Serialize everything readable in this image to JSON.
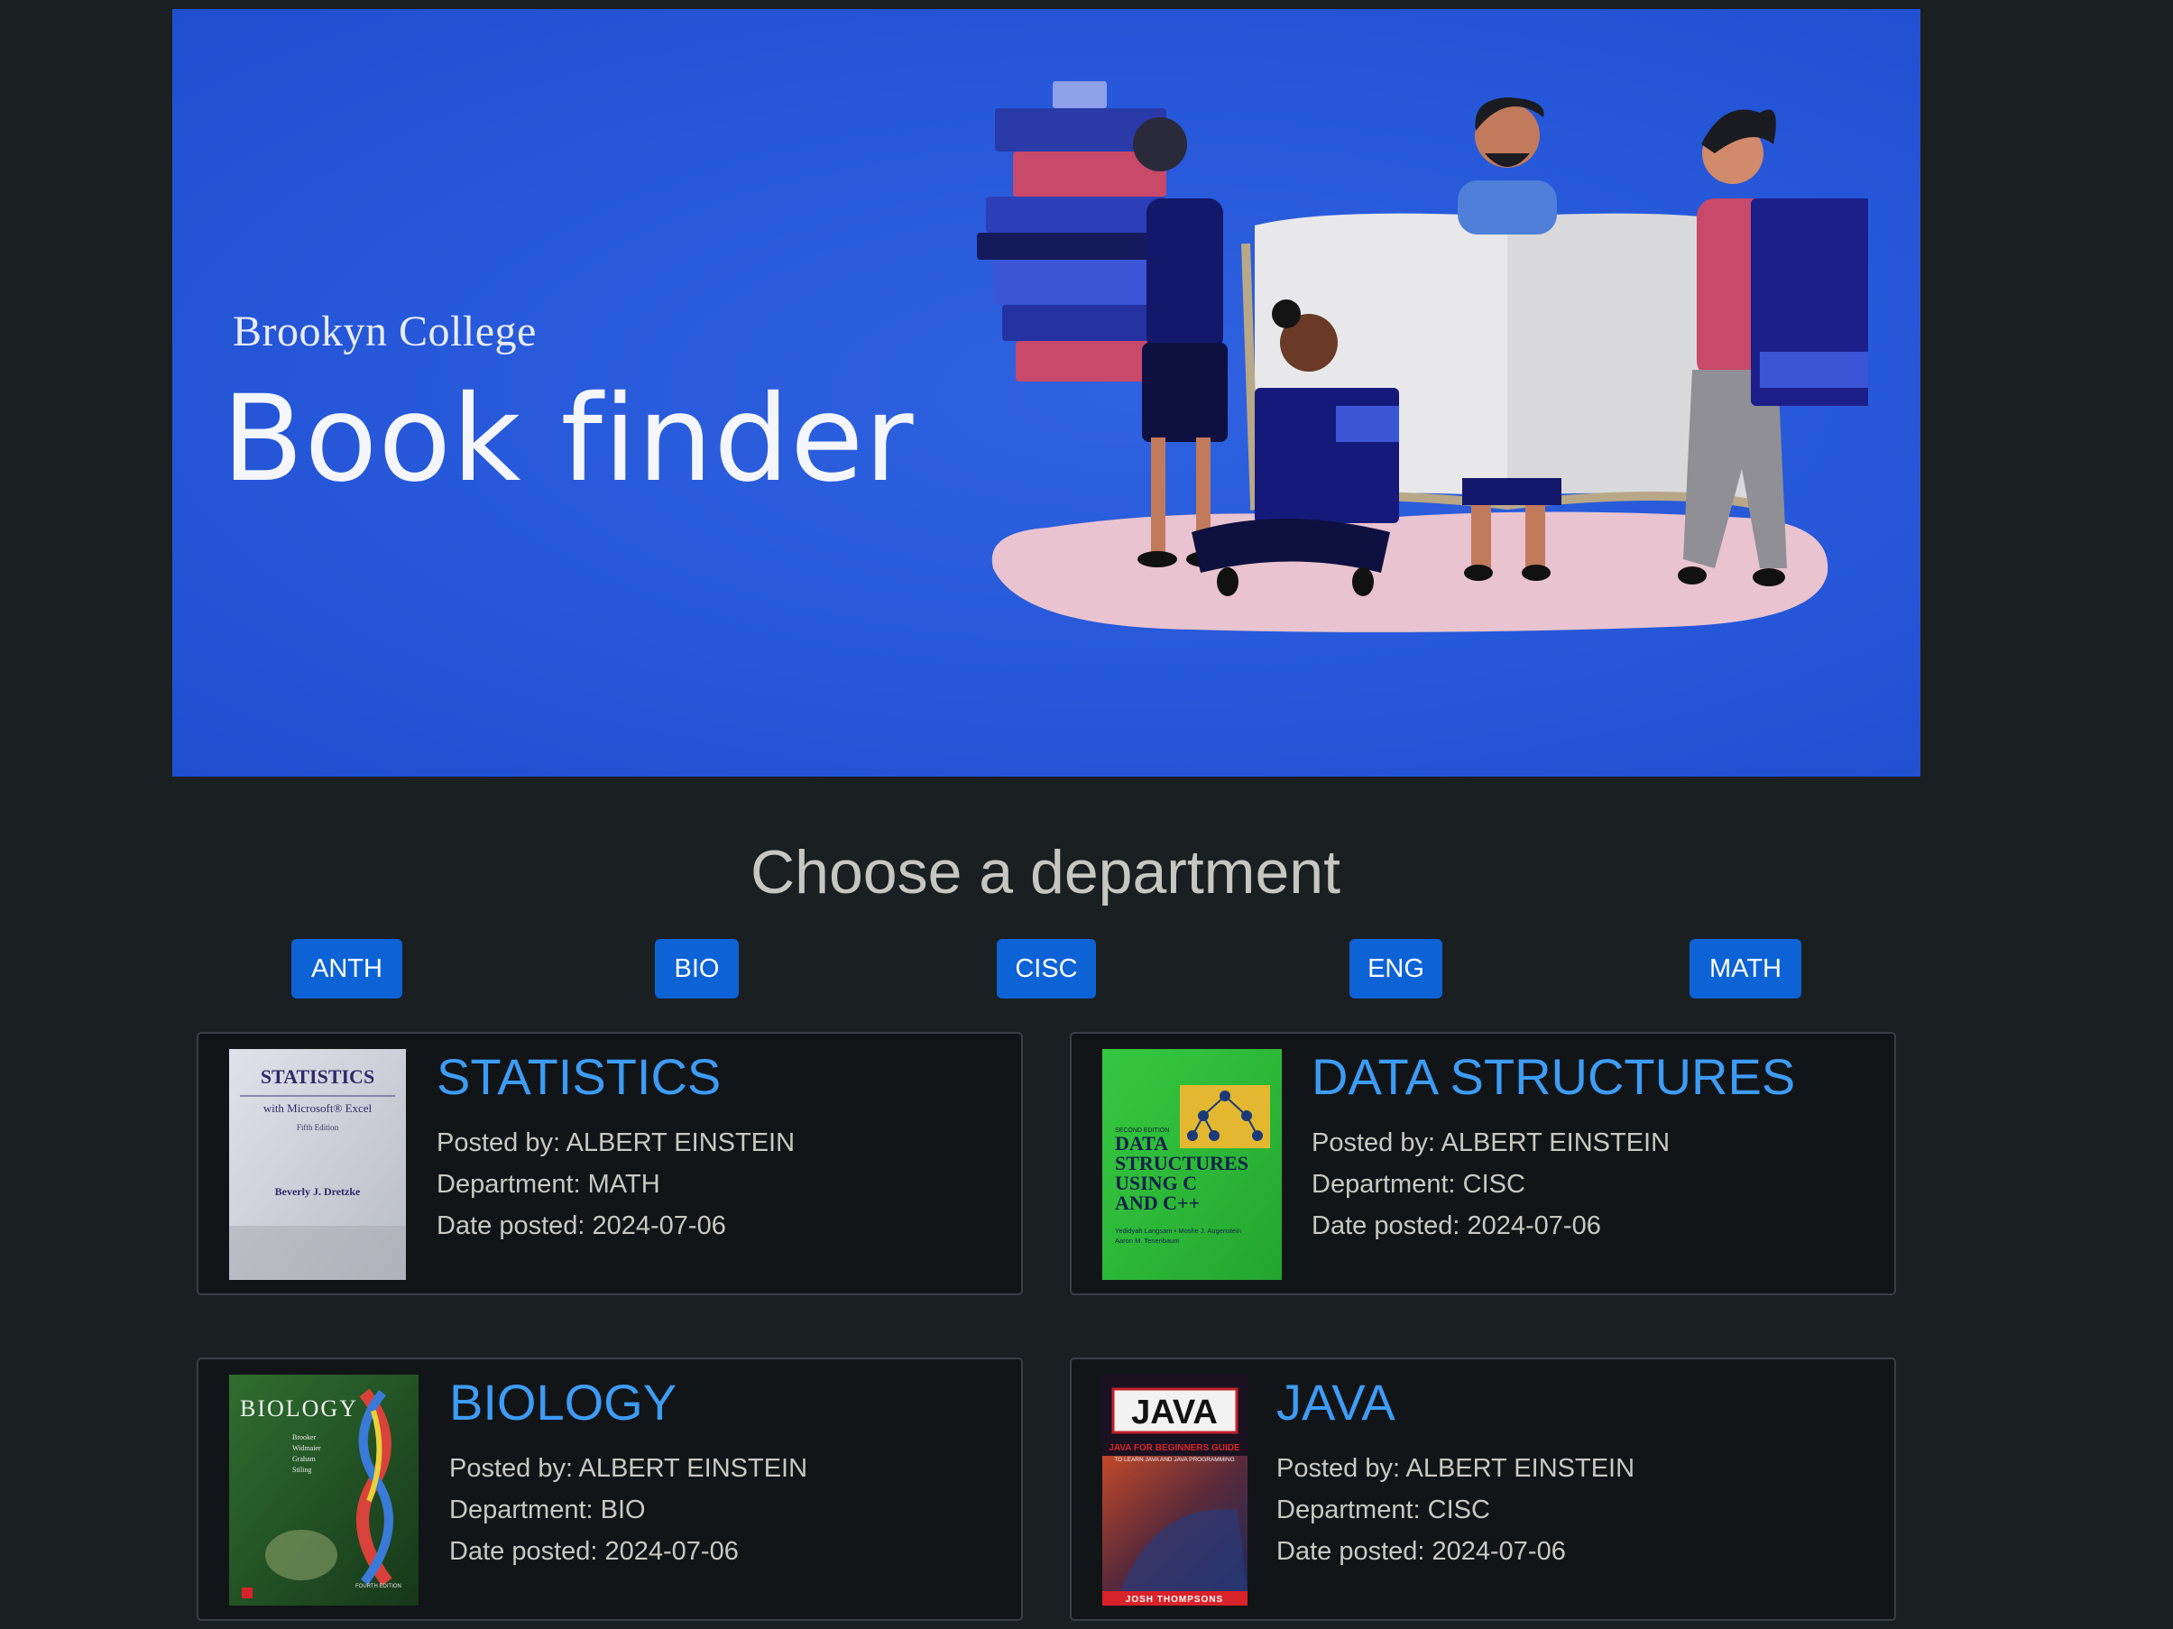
{
  "banner": {
    "subtitle": "Brookyn College",
    "title": "Book finder"
  },
  "heading": "Choose a department",
  "departments": [
    "ANTH",
    "BIO",
    "CISC",
    "ENG",
    "MATH"
  ],
  "books": [
    {
      "title": "STATISTICS",
      "posted_by": "Posted by: ALBERT EINSTEIN",
      "department": "Department: MATH",
      "date_posted": "Date posted: 2024-07-06",
      "cover": {
        "title": "STATISTICS",
        "subtitle": "with Microsoft® Excel",
        "edition": "Fifth Edition",
        "author": "Beverly J. Dretzke"
      }
    },
    {
      "title": "DATA STRUCTURES",
      "posted_by": "Posted by: ALBERT EINSTEIN",
      "department": "Department: CISC",
      "date_posted": "Date posted: 2024-07-06",
      "cover": {
        "edition": "SECOND EDITION",
        "line1": "DATA",
        "line2": "STRUCTURES",
        "line3": "USING C",
        "line4": "AND C++",
        "authors1": "Yedidyah Langsam • Moshe J. Augenstein",
        "authors2": "Aaron M. Tenenbaum"
      }
    },
    {
      "title": "BIOLOGY",
      "posted_by": "Posted by: ALBERT EINSTEIN",
      "department": "Department: BIO",
      "date_posted": "Date posted: 2024-07-06",
      "cover": {
        "title": "BIOLOGY",
        "authors": [
          "Brooker",
          "Widmaier",
          "Graham",
          "Stiling"
        ],
        "edition": "FOURTH EDITION"
      }
    },
    {
      "title": "JAVA",
      "posted_by": "Posted by: ALBERT EINSTEIN",
      "department": "Department: CISC",
      "date_posted": "Date posted: 2024-07-06",
      "cover": {
        "title": "JAVA",
        "tagline": "JAVA FOR BEGINNERS GUIDE",
        "subtitle": "TO LEARN JAVA AND JAVA PROGRAMMING",
        "author": "JOSH THOMPSONS"
      }
    }
  ]
}
